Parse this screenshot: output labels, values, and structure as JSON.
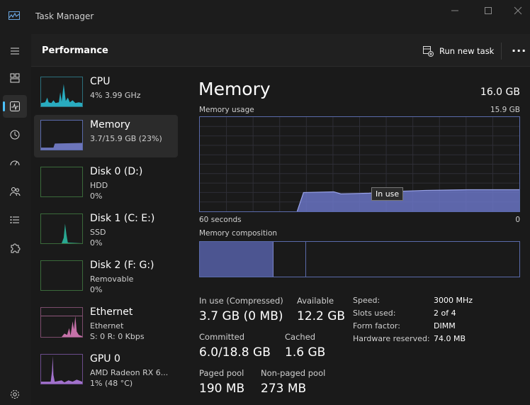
{
  "window": {
    "title": "Task Manager"
  },
  "header": {
    "title": "Performance",
    "run_new_task": "Run new task"
  },
  "resources": [
    {
      "name": "CPU",
      "line1": "4% 3.99 GHz",
      "line2": ""
    },
    {
      "name": "Memory",
      "line1": "3.7/15.9 GB (23%)",
      "line2": ""
    },
    {
      "name": "Disk 0 (D:)",
      "line1": "HDD",
      "line2": "0%"
    },
    {
      "name": "Disk 1 (C: E:)",
      "line1": "SSD",
      "line2": "0%"
    },
    {
      "name": "Disk 2 (F: G:)",
      "line1": "Removable",
      "line2": "0%"
    },
    {
      "name": "Ethernet",
      "line1": "Ethernet",
      "line2": "S: 0 R: 0 Kbps"
    },
    {
      "name": "GPU 0",
      "line1": "AMD Radeon RX 6...",
      "line2": "1% (48 °C)"
    }
  ],
  "memory": {
    "title": "Memory",
    "total": "16.0 GB",
    "usage_label": "Memory usage",
    "usage_max": "15.9 GB",
    "time_left": "60 seconds",
    "time_right": "0",
    "tooltip": "In use",
    "composition_label": "Memory composition",
    "composition": {
      "in_use_fraction": 0.23,
      "modified_fraction": 0.1
    },
    "stats": {
      "in_use_label": "In use (Compressed)",
      "in_use_value": "3.7 GB (0 MB)",
      "available_label": "Available",
      "available_value": "12.2 GB",
      "committed_label": "Committed",
      "committed_value": "6.0/18.8 GB",
      "cached_label": "Cached",
      "cached_value": "1.6 GB",
      "paged_label": "Paged pool",
      "paged_value": "190 MB",
      "nonpaged_label": "Non-paged pool",
      "nonpaged_value": "273 MB"
    },
    "details": [
      {
        "key": "Speed:",
        "value": "3000 MHz"
      },
      {
        "key": "Slots used:",
        "value": "2 of 4"
      },
      {
        "key": "Form factor:",
        "value": "DIMM"
      },
      {
        "key": "Hardware reserved:",
        "value": "74.0 MB"
      }
    ]
  },
  "colors": {
    "cpu": "#2bbcd3",
    "memory": "#7b86d8",
    "disk_ssd": "#2bb8a0",
    "ethernet": "#d87bb8",
    "gpu": "#b07be0",
    "accent": "#4cc2ff"
  }
}
